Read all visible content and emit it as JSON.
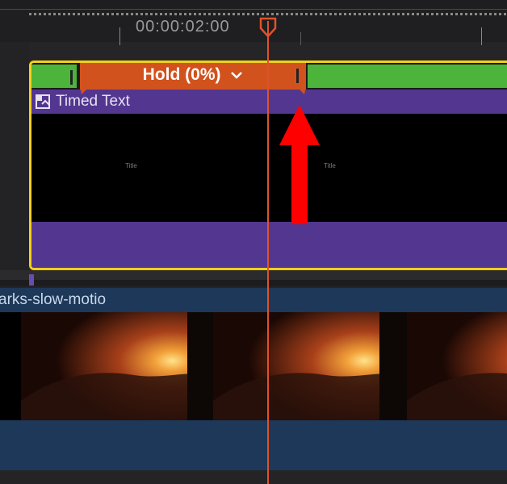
{
  "ruler": {
    "timecode": "00:00:02:00"
  },
  "title_clip": {
    "retime_label": "Hold (0%)",
    "name": "Timed Text",
    "thumbnail_labels": [
      "Title",
      "Title"
    ]
  },
  "video_clip": {
    "name": "arks-slow-motio"
  },
  "colors": {
    "selection_border": "#f4cf1b",
    "retime_normal": "#4cb43a",
    "retime_hold": "#d2521d",
    "title_clip": "#533690",
    "video_clip": "#1d3858",
    "playhead": "#e0522a",
    "annotation_arrow": "#ff0000"
  },
  "icons": {
    "clip_icon": "title-clip-icon",
    "dropdown": "chevron-down-icon",
    "annotation": "red-up-arrow"
  }
}
